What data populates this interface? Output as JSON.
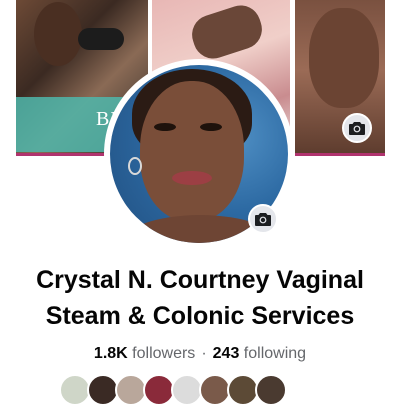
{
  "cover": {
    "banner_text": "BE",
    "colors": {
      "accent_bar": "#b0336e",
      "teal_band": "#4fb7ab"
    }
  },
  "profile": {
    "name_line_1": "Crystal N. Courtney Vaginal",
    "name_line_2": "Steam & Colonic Services"
  },
  "stats": {
    "followers_count": "1.8K",
    "followers_label": "followers",
    "separator": "·",
    "following_count": "243",
    "following_label": "following"
  },
  "mutual_friends": [
    {
      "color": "#cfd6c8"
    },
    {
      "color": "#3a2a24"
    },
    {
      "color": "#b9a79b"
    },
    {
      "color": "#8a2a3a"
    },
    {
      "color": "#dcdcdc"
    },
    {
      "color": "#7a5a4a"
    },
    {
      "color": "#5c4a36"
    },
    {
      "color": "#4a3a30"
    }
  ],
  "icons": {
    "cover_camera": "camera-icon",
    "profile_camera": "camera-icon"
  }
}
